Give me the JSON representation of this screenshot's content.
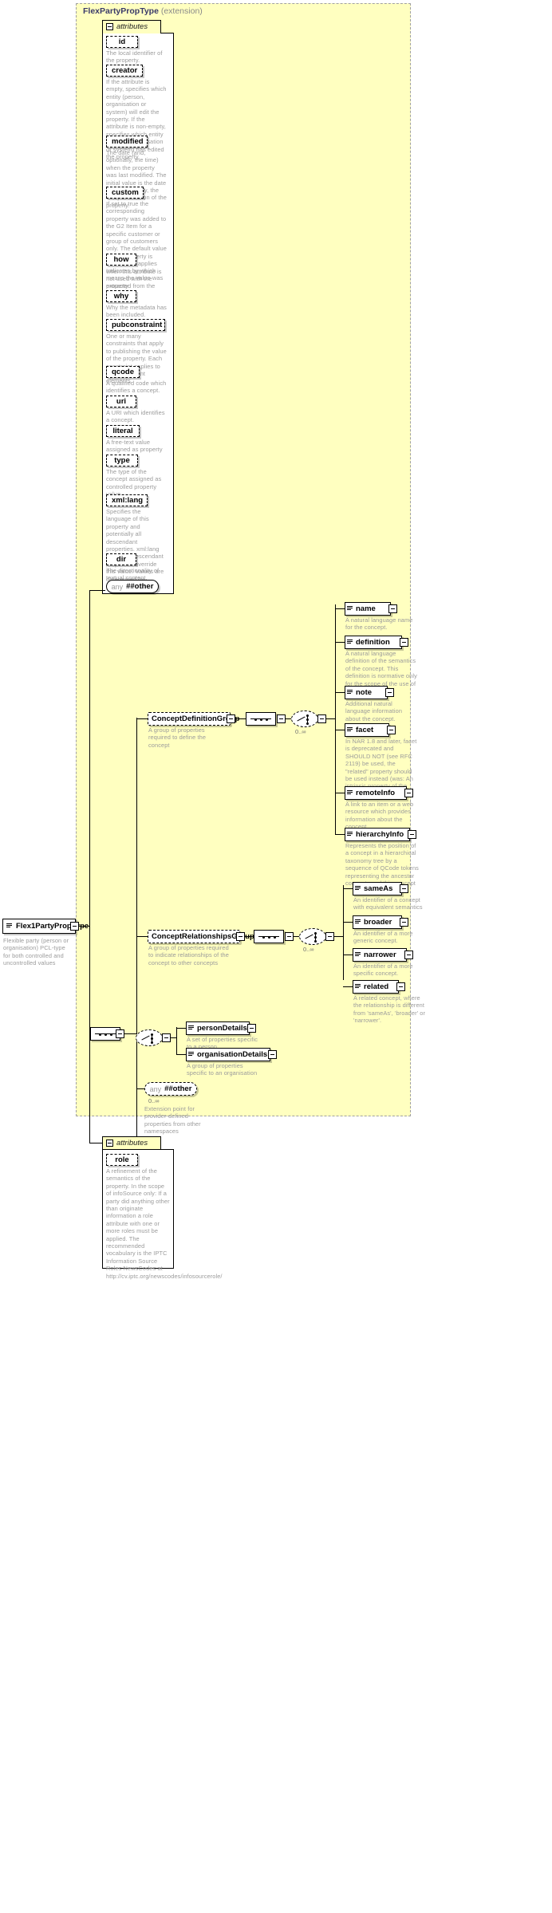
{
  "diagram": {
    "title": "FlexPartyPropType (extension)",
    "title_main": "FlexPartyPropType",
    "title_suffix": "(extension)",
    "attributes_label": "attributes",
    "attributes_label_2": "attributes"
  },
  "root": {
    "name": "Flex1PartyPropType",
    "doc": "Flexible party (person or organisation) PCL-type for both controlled and uncontrolled values"
  },
  "attributes_top": [
    {
      "name": "id",
      "doc": "The local identifier of the property."
    },
    {
      "name": "creator",
      "doc": "If the attribute is empty, specifies which entity (person, organisation or system) will edit the property. If the attribute is non-empty, specifies which entity (person, organisation or system) has edited the property."
    },
    {
      "name": "modified",
      "doc": "The date (and, optionally, the time) when the property was last modified. The initial value is the date (and, optionally, the time) of creation of the property."
    },
    {
      "name": "custom",
      "doc": "If set to true the corresponding property was added to the G2 Item for a specific customer or group of customers only. The default value of this property is false which applies when this attribute is not used with the property."
    },
    {
      "name": "how",
      "doc": "Indicates by which means the value was extracted from the content."
    },
    {
      "name": "why",
      "doc": "Why the metadata has been included."
    },
    {
      "name": "pubconstraint",
      "doc": "One or many constraints that apply to publishing the value of the property. Each constraint applies to all descendant elements."
    },
    {
      "name": "qcode",
      "doc": "A qualified code which identifies a concept."
    },
    {
      "name": "uri",
      "doc": "A URI which identifies a concept."
    },
    {
      "name": "literal",
      "doc": "A free-text value assigned as property value."
    },
    {
      "name": "type",
      "doc": "The type of the concept assigned as controlled property value."
    },
    {
      "name": "xml:lang",
      "doc": "Specifies the language of this property and potentially all descendant properties. xml:lang values of descendant properties override this value. Values are determined by Internet BCP 47."
    },
    {
      "name": "dir",
      "doc": "The directionality of textual content."
    }
  ],
  "any_top": {
    "keyword": "any",
    "namespace": "##other"
  },
  "concept_definition_group": {
    "name": "ConceptDefinitionGroup",
    "doc": "A group of properties required to define the concept",
    "occurrence": "0..∞",
    "elements": [
      {
        "name": "name",
        "doc": "A natural language name for the concept."
      },
      {
        "name": "definition",
        "doc": "A natural language definition of the semantics of the concept. This definition is normative only for the scope of the use of this concept."
      },
      {
        "name": "note",
        "doc": "Additional natural language information about the concept."
      },
      {
        "name": "facet",
        "doc": "In NAR 1.8 and later, facet is deprecated and SHOULD NOT (see RFC 2119) be used, the \"related\" property should be used instead (was: An intrinsic property of the concept.)"
      },
      {
        "name": "remoteInfo",
        "doc": "A link to an item or a web resource which provides information about the concept"
      },
      {
        "name": "hierarchyInfo",
        "doc": "Represents the position of a concept in a hierarchical taxonomy tree by a sequence of QCode tokens representing the ancestor concepts and this concept"
      }
    ]
  },
  "concept_relationships_group": {
    "name": "ConceptRelationshipsGroup",
    "doc": "A group of properties required to indicate relationships of the concept to other concepts",
    "occurrence": "0..∞",
    "elements": [
      {
        "name": "sameAs",
        "doc": "An identifier of a concept with equivalent semantics"
      },
      {
        "name": "broader",
        "doc": "An identifier of a more generic concept."
      },
      {
        "name": "narrower",
        "doc": "An identifier of a more specific concept."
      },
      {
        "name": "related",
        "doc": "A related concept, where the relationship is different from 'sameAs', 'broader' or 'narrower'."
      }
    ]
  },
  "detail_elements": [
    {
      "name": "personDetails",
      "doc": "A set of properties specific to a person"
    },
    {
      "name": "organisationDetails",
      "doc": "A group of properties specific to an organisation"
    }
  ],
  "any_bottom": {
    "keyword": "any",
    "namespace": "##other",
    "occurrence": "0..∞",
    "doc": "Extension point for provider-defined properties from other namespaces"
  },
  "attributes_bottom": [
    {
      "name": "role",
      "doc": "A refinement of the semantics of the property. In the scope of infoSource only: If a party did anything other than originate information a role attribute with one or more roles must be applied. The recommended vocabulary is the IPTC Information Source Roles NewsCodes at http://cv.iptc.org/newscodes/infosourcerole/"
    }
  ]
}
